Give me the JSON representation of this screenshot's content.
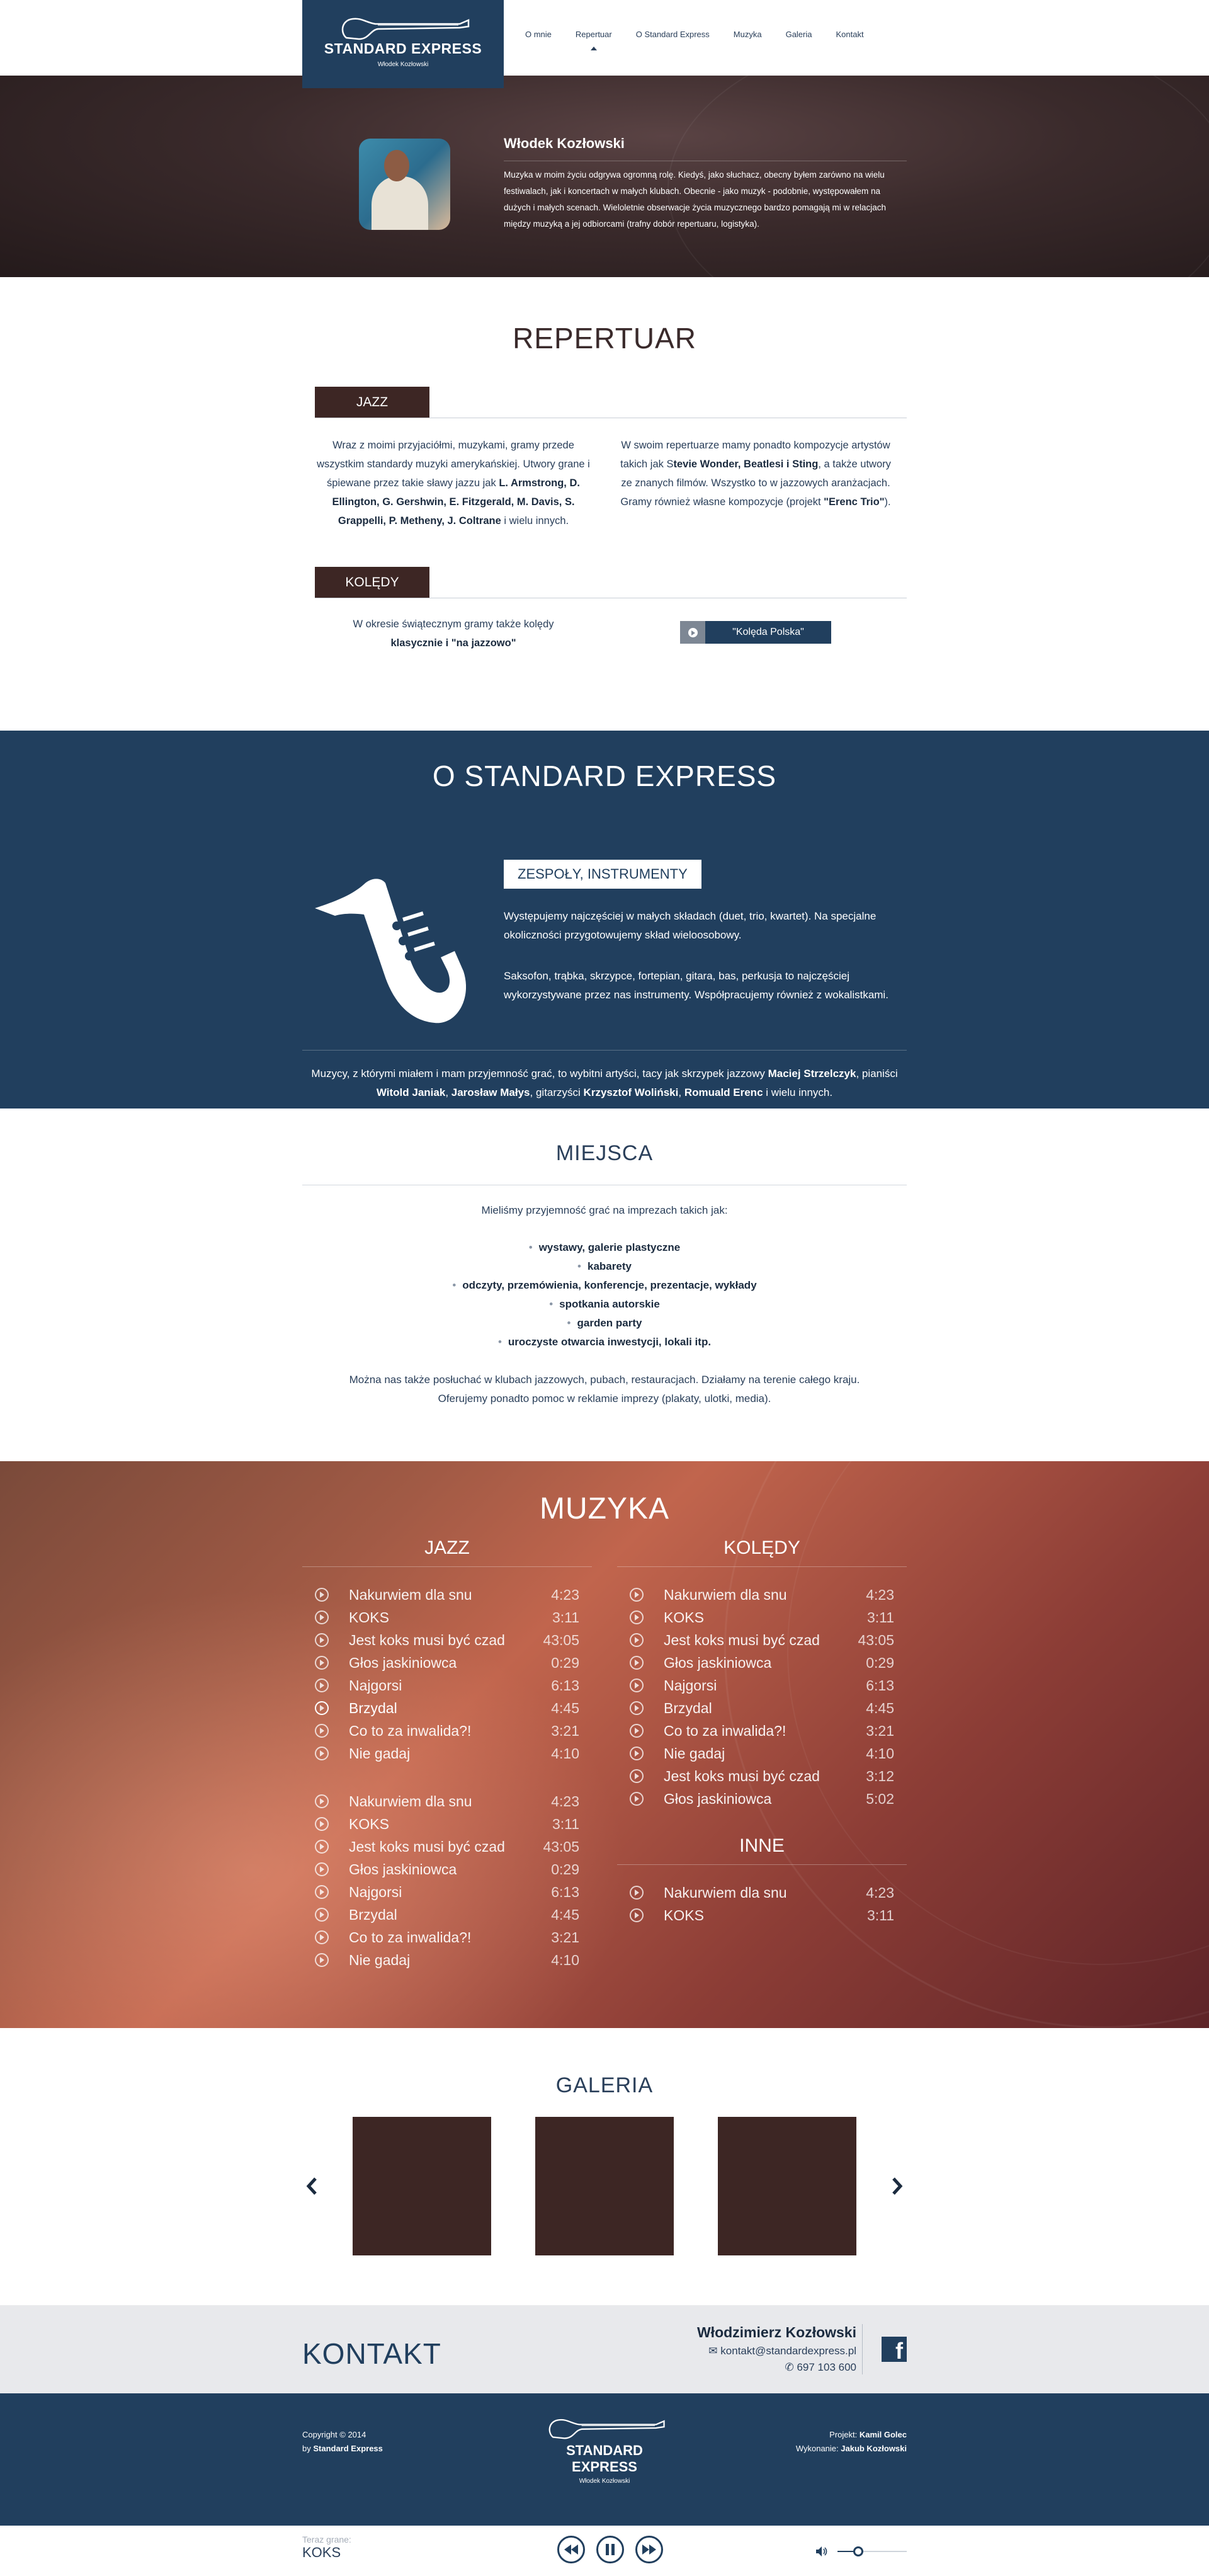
{
  "brand": {
    "name": "STANDARD EXPRESS",
    "sub": "Włodek Kozłowski"
  },
  "nav": [
    {
      "label": "O mnie",
      "active": false
    },
    {
      "label": "Repertuar",
      "active": true
    },
    {
      "label": "O Standard Express",
      "active": false
    },
    {
      "label": "Muzyka",
      "active": false
    },
    {
      "label": "Galeria",
      "active": false
    },
    {
      "label": "Kontakt",
      "active": false
    }
  ],
  "about": {
    "name": "Włodek Kozłowski",
    "text": "Muzyka w moim życiu odgrywa ogromną rolę. Kiedyś, jako słuchacz, obecny byłem zarówno na wielu festiwalach, jak i koncertach w małych klubach. Obecnie - jako muzyk - podobnie, występowałem na dużych i małych scenach. Wieloletnie obserwacje życia muzycznego bardzo pomagają mi w relacjach między muzyką a jej odbiorcami (trafny dobór repertuaru, logistyka)."
  },
  "repertuar": {
    "title": "REPERTUAR",
    "jazz": {
      "tab": "JAZZ",
      "col1_a": "Wraz z moimi przyjaciółmi, muzykami, gramy przede wszystkim standardy muzyki amerykańskiej. Utwory grane i śpiewane przez takie sławy jazzu jak ",
      "col1_b": "L. Armstrong, D. Ellington, G. Gershwin, E. Fitzgerald, M. Davis, S. Grappelli, P. Metheny, J. Coltrane",
      "col1_c": " i wielu innych.",
      "col2_a": "W swoim repertuarze mamy ponadto kompozycje artystów takich jak S",
      "col2_b": "tevie Wonder, Beatlesi i Sting",
      "col2_c": ", a także utwory ze znanych filmów. Wszystko to w jazzowych aranżacjach. Gramy również własne kompozycje (projekt ",
      "col2_d": "\"Erenc Trio\"",
      "col2_e": ")."
    },
    "koledy": {
      "tab": "KOLĘDY",
      "text_a": "W okresie świątecznym gramy także kolędy",
      "text_b": "klasycznie i \"na jazzowo\"",
      "button": "\"Kolęda Polska\""
    }
  },
  "ose": {
    "title": "O STANDARD EXPRESS",
    "badge": "ZESPOŁY, INSTRUMENTY",
    "t1": "Występujemy najczęściej w małych składach (duet, trio, kwartet). Na specjalne okoliczności przygotowujemy skład wieloosobowy.",
    "t2": "Saksofon, trąbka, skrzypce, fortepian, gitara, bas, perkusja to najczęściej wykorzystywane przez nas instrumenty. Współpracujemy również z wokalistkami.",
    "t3_a": "Muzycy, z którymi miałem i mam przyjemność grać, to wybitni artyści, tacy jak skrzypek jazzowy ",
    "t3_b": "Maciej Strzelczyk",
    "t3_c": ", pianiści ",
    "t3_d": "Witold Janiak",
    "t3_e": ", ",
    "t3_f": "Jarosław Małys",
    "t3_g": ", gitarzyści ",
    "t3_h": "Krzysztof Woliński",
    "t3_i": ", ",
    "t3_j": "Romuald Erenc",
    "t3_k": " i wielu innych."
  },
  "miejsca": {
    "title": "MIEJSCA",
    "intro": "Mieliśmy przyjemność grać na imprezach takich jak:",
    "items": [
      "wystawy, galerie plastyczne",
      "kabarety",
      "odczyty, przemówienia, konferencje, prezentacje, wykłady",
      "spotkania autorskie",
      "garden party",
      "uroczyste otwarcia inwestycji, lokali itp."
    ],
    "outro1": "Można nas także posłuchać w klubach jazzowych, pubach, restauracjach. Działamy na terenie całego kraju.",
    "outro2": "Oferujemy ponadto pomoc w reklamie imprezy (plakaty, ulotki, media)."
  },
  "muzyka": {
    "title": "MUZYKA",
    "jazz_title": "JAZZ",
    "jazz_a": [
      {
        "name": "Nakurwiem dla snu",
        "dur": "4:23"
      },
      {
        "name": "KOKS",
        "dur": "3:11"
      },
      {
        "name": "Jest koks musi być czad",
        "dur": "43:05"
      },
      {
        "name": "Głos jaskiniowca",
        "dur": "0:29"
      },
      {
        "name": "Najgorsi",
        "dur": "6:13"
      },
      {
        "name": "Brzydal",
        "dur": "4:45"
      },
      {
        "name": "Co to za inwalida?!",
        "dur": "3:21"
      },
      {
        "name": "Nie gadaj",
        "dur": "4:10"
      }
    ],
    "jazz_b": [
      {
        "name": "Nakurwiem dla snu",
        "dur": "4:23"
      },
      {
        "name": "KOKS",
        "dur": "3:11"
      },
      {
        "name": "Jest koks musi być czad",
        "dur": "43:05"
      },
      {
        "name": "Głos jaskiniowca",
        "dur": "0:29"
      },
      {
        "name": "Najgorsi",
        "dur": "6:13"
      },
      {
        "name": "Brzydal",
        "dur": "4:45"
      },
      {
        "name": "Co to za inwalida?!",
        "dur": "3:21"
      },
      {
        "name": "Nie gadaj",
        "dur": "4:10"
      }
    ],
    "koledy_title": "KOLĘDY",
    "koledy": [
      {
        "name": "Nakurwiem dla snu",
        "dur": "4:23"
      },
      {
        "name": "KOKS",
        "dur": "3:11"
      },
      {
        "name": "Jest koks musi być czad",
        "dur": "43:05"
      },
      {
        "name": "Głos jaskiniowca",
        "dur": "0:29"
      },
      {
        "name": "Najgorsi",
        "dur": "6:13"
      },
      {
        "name": "Brzydal",
        "dur": "4:45"
      },
      {
        "name": "Co to za inwalida?!",
        "dur": "3:21"
      },
      {
        "name": "Nie gadaj",
        "dur": "4:10"
      },
      {
        "name": "Jest koks musi być czad",
        "dur": "3:12"
      },
      {
        "name": "Głos jaskiniowca",
        "dur": "5:02"
      }
    ],
    "inne_title": "INNE",
    "inne": [
      {
        "name": "Nakurwiem dla snu",
        "dur": "4:23"
      },
      {
        "name": "KOKS",
        "dur": "3:11"
      }
    ],
    "current_index_jazz_a": 5
  },
  "galeria": {
    "title": "GALERIA",
    "count": 3
  },
  "kontakt": {
    "title": "KONTAKT",
    "name": "Włodzimierz Kozłowski",
    "email": "kontakt@standardexpress.pl",
    "phone": "697 103 600"
  },
  "footer": {
    "copy1": "Copyright © 2014",
    "copy2_a": "by ",
    "copy2_b": "Standard Express",
    "proj_a": "Projekt: ",
    "proj_b": "Kamil Golec",
    "wyk_a": "Wykonanie: ",
    "wyk_b": "Jakub Kozłowski"
  },
  "player": {
    "label": "Teraz grane:",
    "track": "KOKS",
    "volume": 0.3
  },
  "colors": {
    "navy": "#213f5e",
    "brown": "#3d2624",
    "text": "#2a3f5a"
  }
}
